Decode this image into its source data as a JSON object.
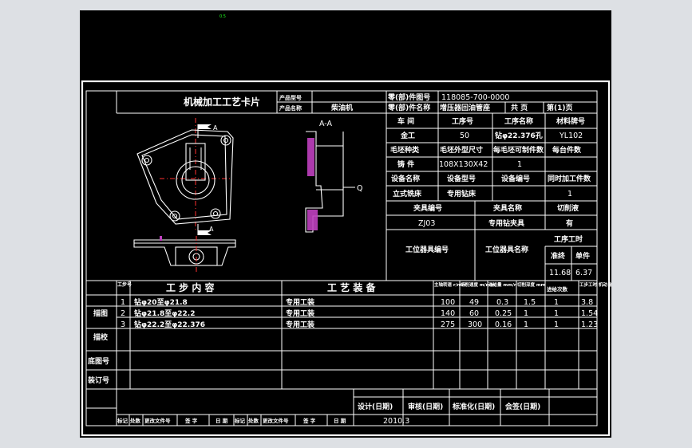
{
  "viewport_marker": "0.5",
  "card_title": "机械加工工艺卡片",
  "header": {
    "product_model_label": "产品型号",
    "product_model_value": "",
    "product_name_label": "产品名称",
    "product_name_value": "柴油机",
    "part_no_label": "零(部)件图号",
    "part_no_value": "118085-700-0000",
    "part_name_label": "零(部)件名称",
    "part_name_value": "增压器回油管座",
    "total_pages_label": "共 页",
    "page_label": "第(1)页"
  },
  "info": {
    "r1": [
      "车 间",
      "工序号",
      "工序名称",
      "材料牌号"
    ],
    "r2": [
      "金工",
      "50",
      "钻φ22.376孔",
      "YL102"
    ],
    "r3": [
      "毛坯种类",
      "毛坯外型尺寸",
      "每毛坯可制件数",
      "每台件数"
    ],
    "r4": [
      "铸 件",
      "108X130X42",
      "1",
      ""
    ],
    "r5": [
      "设备名称",
      "设备型号",
      "设备编号",
      "同时加工件数"
    ],
    "r6": [
      "立式铣床",
      "专用钻床",
      "",
      "1"
    ],
    "r7": [
      "夹具编号",
      "夹具名称",
      "切削液"
    ],
    "r8": [
      "ZJ03",
      "专用钻夹具",
      "有"
    ],
    "station_tool_no_label": "工位器具编号",
    "station_tool_name_label": "工位器具名称",
    "op_time_label": "工序工时",
    "quasi_end_label": "准终",
    "unit_label": "单件",
    "quasi_end_value": "11.68",
    "unit_value": "6.37"
  },
  "drawing": {
    "section_label": "A-A",
    "cut_mark": "A",
    "cut_mark_bottom": "A",
    "surface_label": "Q"
  },
  "steps_header": {
    "step_no": "工步号",
    "step_content": "工 步 内 容",
    "equipment": "工 艺 装 备",
    "spindle_speed": "主轴转速 r/min",
    "cutting_speed": "切削速度 m/min",
    "feed": "进给量 mm/r",
    "depth": "切削深度 mm",
    "passes": "进给次数",
    "time": "工步工时 机动 辅助"
  },
  "steps": [
    {
      "no": "1",
      "content": "钻φ20至φ21.8",
      "equip": "专用工装",
      "speed": "100",
      "vc": "49",
      "feed": "0.3",
      "depth": "1.5",
      "passes": "1",
      "time": "3.8"
    },
    {
      "no": "2",
      "content": "钻φ21.8至φ22.2",
      "equip": "专用工装",
      "speed": "140",
      "vc": "60",
      "feed": "0.25",
      "depth": "1",
      "passes": "1",
      "time": "1.54"
    },
    {
      "no": "3",
      "content": "钻φ22.2至φ22.376",
      "equip": "专用工装",
      "speed": "275",
      "vc": "300",
      "feed": "0.16",
      "depth": "1",
      "passes": "1",
      "time": "1.23"
    }
  ],
  "side_labels": [
    "描图",
    "描校",
    "底图号",
    "装订号"
  ],
  "footer": {
    "design": "设计(日期)",
    "review": "审核(日期)",
    "standard": "标准化(日期)",
    "countersign": "会签(日期)",
    "date_value": "2010.3",
    "revision_labels": [
      "标记",
      "处数",
      "更改文件号",
      "签 字",
      "日 期",
      "标记",
      "处数",
      "更改文件号",
      "签 字",
      "日 期"
    ]
  },
  "colors": {
    "background": "#000000",
    "lines": "#ffffff",
    "centerline": "#ff3030",
    "hatch": "#c040c0",
    "outer": "#dde0e4"
  }
}
